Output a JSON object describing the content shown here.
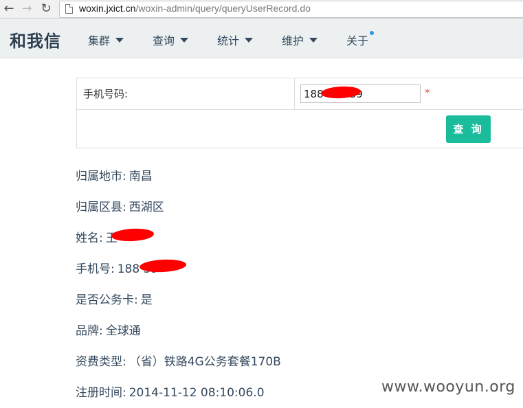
{
  "browser": {
    "url_host": "woxin.jxict.cn",
    "url_path": "/woxin-admin/query/queryUserRecord.do"
  },
  "navbar": {
    "brand": "和我信",
    "menus": [
      {
        "label": "集群"
      },
      {
        "label": "查询"
      },
      {
        "label": "统计"
      },
      {
        "label": "维护"
      },
      {
        "label": "关于"
      }
    ]
  },
  "form": {
    "phone_label": "手机号码:",
    "phone_value": "188        39",
    "required_mark": "*",
    "query_button": "查 询"
  },
  "record": [
    {
      "label": "归属地市:",
      "value": "南昌"
    },
    {
      "label": "归属区县:",
      "value": "西湖区"
    },
    {
      "label": "姓名:",
      "value": "王"
    },
    {
      "label": "手机号:",
      "value": "188        39"
    },
    {
      "label": "是否公务卡:",
      "value": "是"
    },
    {
      "label": "品牌:",
      "value": "全球通"
    },
    {
      "label": "资费类型:",
      "value": "（省）铁路4G公务套餐170B"
    },
    {
      "label": "注册时间:",
      "value": "2014-11-12 08:10:06.0"
    }
  ],
  "watermark": "www.wooyun.org",
  "colors": {
    "navbar_bg": "#ecf0f1",
    "query_button": "#1abc9c",
    "required": "#e74c3c",
    "redaction": "#ff0000"
  },
  "icons": [
    "back-arrow-icon",
    "forward-arrow-icon",
    "reload-icon",
    "page-icon",
    "caret-down-icon"
  ]
}
